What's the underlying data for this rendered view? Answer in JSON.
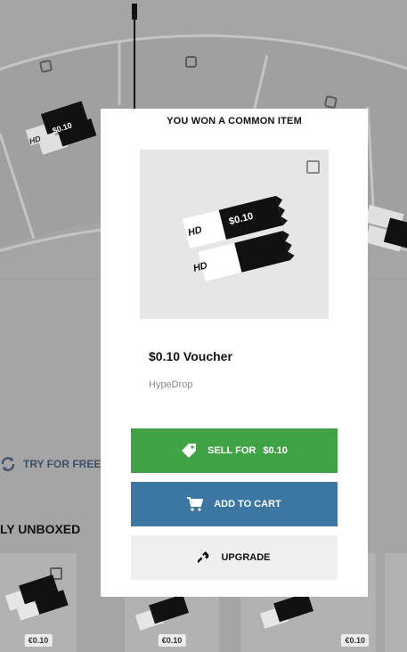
{
  "background": {
    "try_free_label": "TRY FOR FREE",
    "unboxed_title": "LY UNBOXED",
    "card_prices": [
      "€0.10",
      "€0.10",
      "€0.10"
    ],
    "voucher_text": "$0.10",
    "hd_text": "HD"
  },
  "modal": {
    "title": "YOU WON A COMMON ITEM",
    "item": {
      "name": "$0.10 Voucher",
      "brand": "HypeDrop",
      "voucher_text": "$0.10",
      "hd_text": "HD",
      "rarity_icon": "common-box-icon"
    },
    "buttons": {
      "sell": {
        "label": "SELL FOR",
        "amount": "$0.10",
        "icon": "price-tag-icon"
      },
      "cart": {
        "label": "ADD TO CART",
        "icon": "shopping-cart-icon"
      },
      "upgrade": {
        "label": "UPGRADE",
        "icon": "hammer-icon"
      }
    }
  },
  "colors": {
    "sell_green": "#3fa345",
    "cart_blue": "#3b77a2",
    "upgrade_grey": "#efefef",
    "overlay_grey": "#a5a5a5"
  }
}
